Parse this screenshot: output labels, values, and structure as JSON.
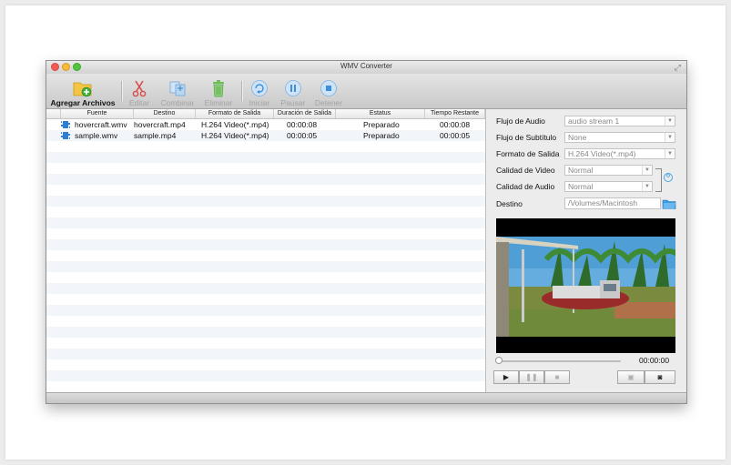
{
  "window": {
    "title": "WMV Converter"
  },
  "toolbar": {
    "add_files": "Agregar Archivos",
    "edit": "Editar",
    "combine": "Combinar",
    "delete": "Eliminar",
    "start": "Iniciar",
    "pause": "Pausar",
    "stop": "Detener"
  },
  "table": {
    "headers": [
      "Fuente",
      "Destino",
      "Formato de Salida",
      "Duración de Salida",
      "Estatus",
      "Tiempo Restante"
    ],
    "rows": [
      {
        "source": "hovercraft.wmv",
        "dest": "hovercraft.mp4",
        "format": "H.264 Video(*.mp4)",
        "duration": "00:00:08",
        "status": "Preparado",
        "remaining": "00:00:08"
      },
      {
        "source": "sample.wmv",
        "dest": "sample.mp4",
        "format": "H.264 Video(*.mp4)",
        "duration": "00:00:05",
        "status": "Preparado",
        "remaining": "00:00:05"
      }
    ]
  },
  "panel": {
    "audio_stream_label": "Flujo de Audio",
    "audio_stream_value": "audio stream 1",
    "subtitle_label": "Flujo de Subtítulo",
    "subtitle_value": "None",
    "format_label": "Formato de Salida",
    "format_value": "H.264 Video(*.mp4)",
    "video_quality_label": "Calidad de Video",
    "video_quality_value": "Normal",
    "audio_quality_label": "Calidad de Audio",
    "audio_quality_value": "Normal",
    "destination_label": "Destino",
    "destination_value": "/Volumes/Macintosh"
  },
  "player": {
    "time": "00:00:00",
    "position": 0
  },
  "colors": {
    "accent": "#2c7fd4",
    "traffic_close": "#f25a52",
    "traffic_min": "#f8bb3a",
    "traffic_max": "#53c43d"
  },
  "icons": [
    "add-files-icon",
    "scissors-icon",
    "combine-icon",
    "trash-icon",
    "start-icon",
    "pause-icon",
    "stop-icon",
    "play-icon",
    "snapshot-icon",
    "camera-icon",
    "folder-icon",
    "link-icon",
    "video-file-icon"
  ]
}
